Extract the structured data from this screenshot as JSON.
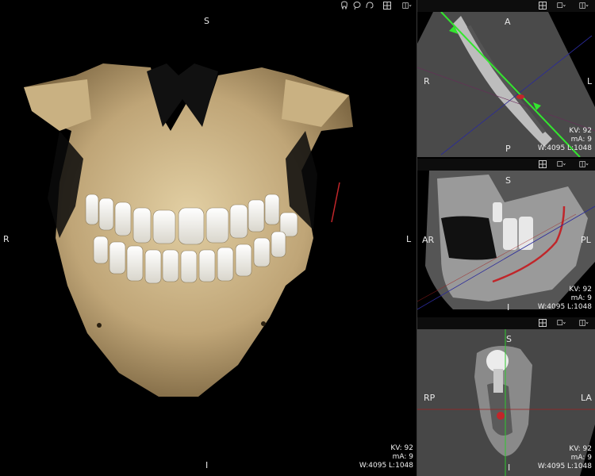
{
  "toolbar": {
    "icons": [
      "tooth-icon",
      "lasso-icon",
      "curve-icon",
      "grid-icon",
      "layout-icon"
    ]
  },
  "main_view": {
    "orient_top": "S",
    "orient_bottom": "I",
    "orient_left": "R",
    "orient_right": "L",
    "kv": "KV: 92",
    "ma": "mA: 9",
    "wl": "W:4095  L:1048"
  },
  "axial_view": {
    "orient_top": "A",
    "orient_bottom": "P",
    "orient_left": "R",
    "orient_right": "L",
    "kv": "KV: 92",
    "ma": "mA: 9",
    "wl": "W:4095  L:1048"
  },
  "sagittal_view": {
    "orient_top": "S",
    "orient_bottom": "I",
    "orient_left": "AR",
    "orient_right": "PL",
    "kv": "KV: 92",
    "ma": "mA: 9",
    "wl": "W:4095  L:1048"
  },
  "cross_view": {
    "orient_top": "S",
    "orient_bottom": "I",
    "orient_left": "RP",
    "orient_right": "LA",
    "kv": "KV: 92",
    "ma": "mA: 9",
    "wl": "W:4095  L:1048"
  },
  "colors": {
    "nerve": "#c0262a",
    "guide_line": "#33e62e",
    "crosshair_red": "#a02020",
    "crosshair_blue": "#2a2a9a",
    "crosshair_green": "#2ec82e",
    "bone": "#d8c49a"
  }
}
